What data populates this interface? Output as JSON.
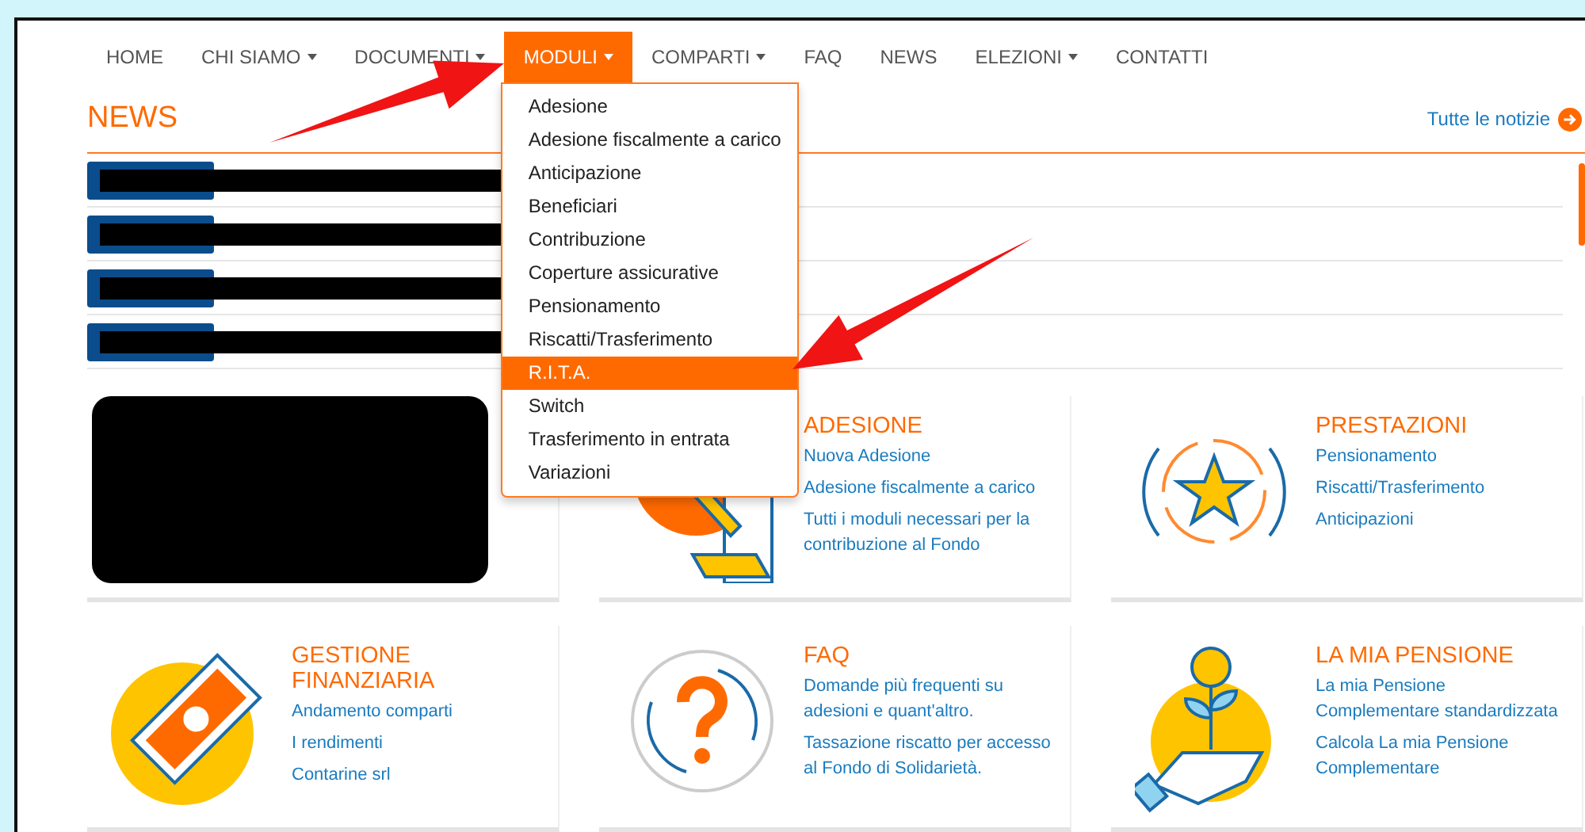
{
  "nav": [
    {
      "label": "HOME",
      "caret": false,
      "selected": false
    },
    {
      "label": "CHI SIAMO",
      "caret": true,
      "selected": false
    },
    {
      "label": "DOCUMENTI",
      "caret": true,
      "selected": false
    },
    {
      "label": "MODULI",
      "caret": true,
      "selected": true
    },
    {
      "label": "COMPARTI",
      "caret": true,
      "selected": false
    },
    {
      "label": "FAQ",
      "caret": false,
      "selected": false
    },
    {
      "label": "NEWS",
      "caret": false,
      "selected": false
    },
    {
      "label": "ELEZIONI",
      "caret": true,
      "selected": false
    },
    {
      "label": "CONTATTI",
      "caret": false,
      "selected": false
    }
  ],
  "dropdown": [
    {
      "label": "Adesione",
      "selected": false
    },
    {
      "label": "Adesione fiscalmente a carico",
      "selected": false
    },
    {
      "label": "Anticipazione",
      "selected": false
    },
    {
      "label": "Beneficiari",
      "selected": false
    },
    {
      "label": "Contribuzione",
      "selected": false
    },
    {
      "label": "Coperture assicurative",
      "selected": false
    },
    {
      "label": "Pensionamento",
      "selected": false
    },
    {
      "label": "Riscatti/Trasferimento",
      "selected": false
    },
    {
      "label": "R.I.T.A.",
      "selected": true
    },
    {
      "label": "Switch",
      "selected": false
    },
    {
      "label": "Trasferimento in entrata",
      "selected": false
    },
    {
      "label": "Variazioni",
      "selected": false
    }
  ],
  "news": {
    "title": "NEWS",
    "all_link": "Tutte le notizie"
  },
  "cards": [
    {
      "kind": "redacted"
    },
    {
      "kind": "links",
      "title": "ADESIONE",
      "links": [
        "Nuova Adesione",
        "Adesione fiscalmente a carico",
        "Tutti i moduli necessari per la contribuzione al Fondo"
      ]
    },
    {
      "kind": "links",
      "title": "PRESTAZIONI",
      "links": [
        "Pensionamento",
        "Riscatti/Trasferimento",
        "Anticipazioni"
      ]
    },
    {
      "kind": "links",
      "title": "GESTIONE FINANZIARIA",
      "links": [
        "Andamento comparti",
        "I rendimenti",
        "Contarine srl"
      ]
    },
    {
      "kind": "links",
      "title": "FAQ",
      "links": [
        "Domande più frequenti su adesioni e quant'altro.",
        "Tassazione riscatto per accesso al Fondo di Solidarietà."
      ]
    },
    {
      "kind": "links",
      "title": "LA MIA PENSIONE",
      "links": [
        "La mia Pensione Complementare standardizzata",
        "Calcola La mia Pensione Complementare"
      ]
    }
  ]
}
